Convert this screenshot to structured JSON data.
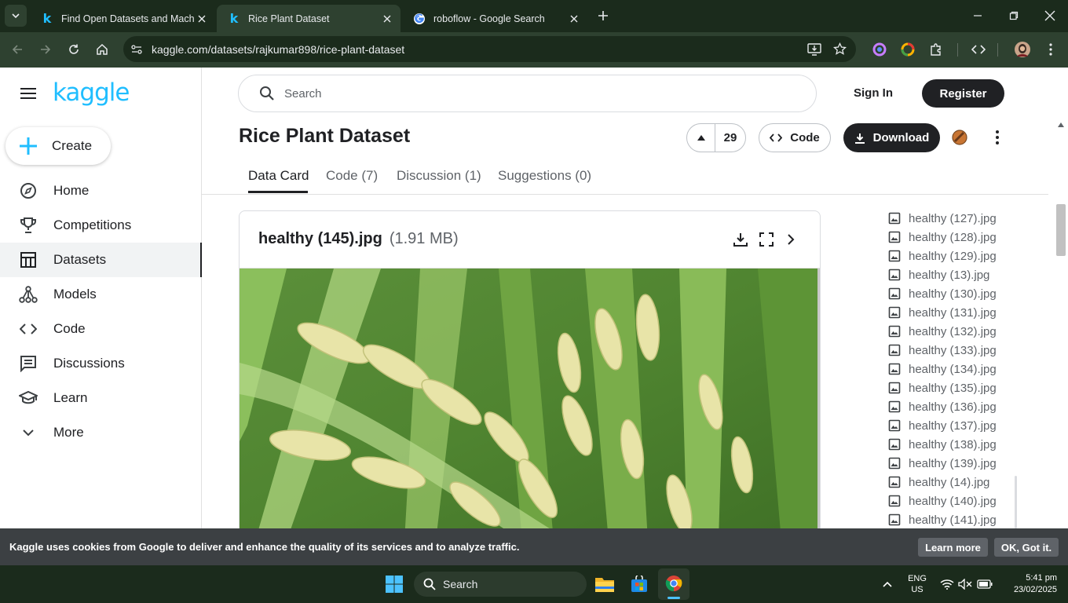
{
  "browser": {
    "tabs": [
      {
        "title": "Find Open Datasets and Machi",
        "icon": "kaggle-k"
      },
      {
        "title": "Rice Plant Dataset",
        "icon": "kaggle-k"
      },
      {
        "title": "roboflow - Google Search",
        "icon": "google-g"
      }
    ],
    "url": "kaggle.com/datasets/rajkumar898/rice-plant-dataset"
  },
  "kaggle": {
    "logo": "kaggle",
    "create_label": "Create",
    "nav": [
      {
        "label": "Home",
        "icon": "compass-icon"
      },
      {
        "label": "Competitions",
        "icon": "trophy-icon"
      },
      {
        "label": "Datasets",
        "icon": "table-icon"
      },
      {
        "label": "Models",
        "icon": "models-icon"
      },
      {
        "label": "Code",
        "icon": "code-icon"
      },
      {
        "label": "Discussions",
        "icon": "discussion-icon"
      },
      {
        "label": "Learn",
        "icon": "learn-icon"
      },
      {
        "label": "More",
        "icon": "chevron-down-icon"
      }
    ],
    "search_placeholder": "Search",
    "sign_in": "Sign In",
    "register": "Register"
  },
  "dataset": {
    "title": "Rice Plant Dataset",
    "votes": "29",
    "code_label": "Code",
    "download_label": "Download",
    "tabs": [
      "Data Card",
      "Code (7)",
      "Discussion (1)",
      "Suggestions (0)"
    ],
    "preview": {
      "filename": "healthy (145).jpg",
      "size": "(1.91 MB)"
    },
    "files": [
      "healthy (127).jpg",
      "healthy (128).jpg",
      "healthy (129).jpg",
      "healthy (13).jpg",
      "healthy (130).jpg",
      "healthy (131).jpg",
      "healthy (132).jpg",
      "healthy (133).jpg",
      "healthy (134).jpg",
      "healthy (135).jpg",
      "healthy (136).jpg",
      "healthy (137).jpg",
      "healthy (138).jpg",
      "healthy (139).jpg",
      "healthy (14).jpg",
      "healthy (140).jpg",
      "healthy (141).jpg"
    ]
  },
  "cookie_banner": {
    "text": "Kaggle uses cookies from Google to deliver and enhance the quality of its services and to analyze traffic.",
    "learn_more": "Learn more",
    "ok": "OK, Got it."
  },
  "taskbar": {
    "search_placeholder": "Search",
    "lang_line1": "ENG",
    "lang_line2": "US",
    "time": "5:41 pm",
    "date": "23/02/2025"
  },
  "colors": {
    "kaggle_blue": "#20beff",
    "chrome_dark": "#1b2b1c",
    "chrome_mid": "#2e4130",
    "button_dark": "#202124"
  }
}
